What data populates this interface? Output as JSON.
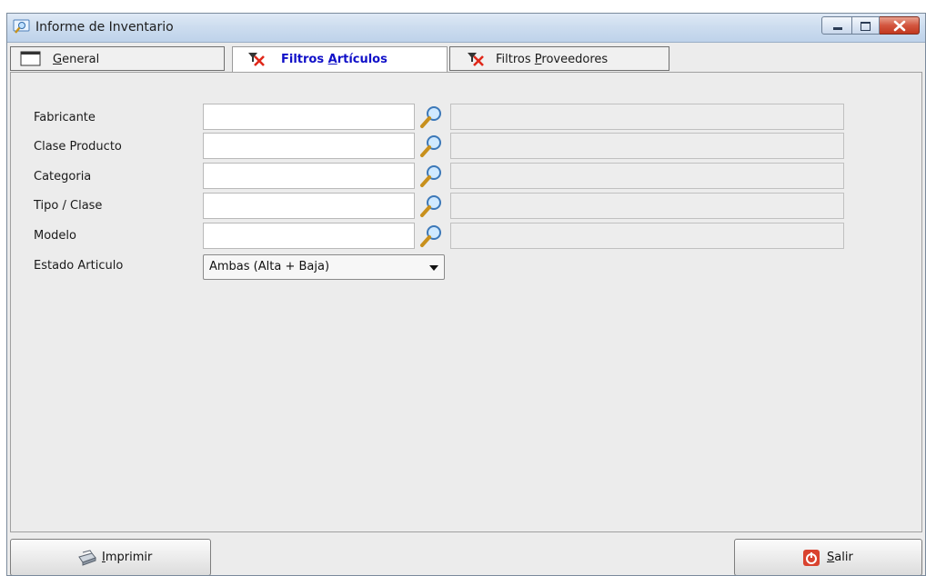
{
  "window": {
    "title": "Informe de Inventario"
  },
  "tabs": [
    {
      "label_pre": "",
      "label_key": "G",
      "label_post": "eneral",
      "active": false
    },
    {
      "label_pre": "Filtros ",
      "label_key": "A",
      "label_post": "rtículos",
      "active": true
    },
    {
      "label_pre": "Filtros ",
      "label_key": "P",
      "label_post": "roveedores",
      "active": false
    }
  ],
  "filters": [
    {
      "label": "Fabricante",
      "value": "",
      "description": ""
    },
    {
      "label": "Clase Producto",
      "value": "",
      "description": ""
    },
    {
      "label": "Categoria",
      "value": "",
      "description": ""
    },
    {
      "label": "Tipo / Clase",
      "value": "",
      "description": ""
    },
    {
      "label": "Modelo",
      "value": "",
      "description": ""
    }
  ],
  "estado": {
    "label": "Estado Articulo",
    "selected": "Ambas (Alta + Baja)"
  },
  "buttons": {
    "print": {
      "key": "I",
      "rest": "mprimir"
    },
    "exit": {
      "key": "S",
      "rest": "alir"
    }
  },
  "colors": {
    "active_tab_text": "#1010c8",
    "exit_icon": "#d9432f"
  }
}
